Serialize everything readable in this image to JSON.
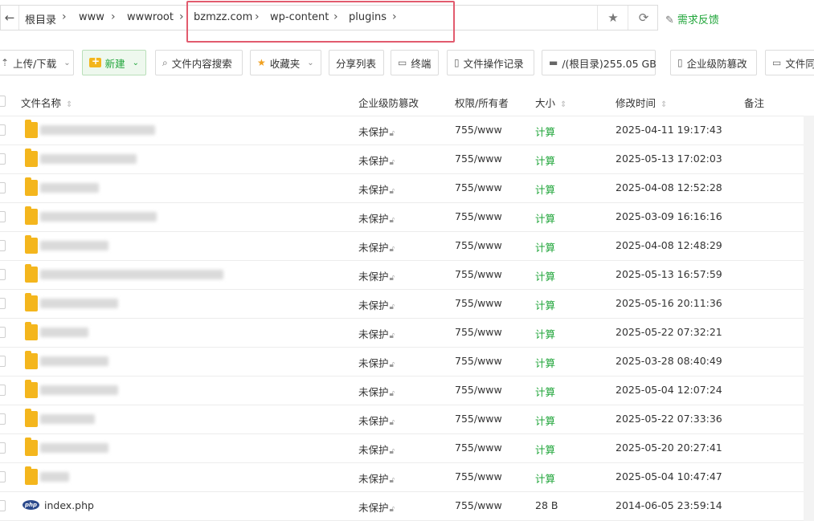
{
  "breadcrumb": {
    "back_icon": "arrow-left-icon",
    "items": [
      "根目录",
      "www",
      "wwwroot",
      "bzmzz.com",
      "wp-content",
      "plugins"
    ],
    "separator": "›"
  },
  "feedback": {
    "label": "需求反馈",
    "icon": "edit-icon"
  },
  "toolbar": {
    "upload": "上传/下载",
    "new": "新建",
    "content_search": "文件内容搜索",
    "favorites": "收藏夹",
    "share_list": "分享列表",
    "terminal": "终端",
    "op_log": "文件操作记录",
    "disk": "/(根目录)255.05 GB",
    "tamper": "企业级防篡改",
    "more": "文件同"
  },
  "table": {
    "columns": {
      "name": "文件名称",
      "protect": "企业级防篡改",
      "perm": "权限/所有者",
      "size": "大小",
      "mtime": "修改时间",
      "note": "备注"
    },
    "rows": [
      {
        "type": "folder",
        "protect": "未保护",
        "perm": "755/www",
        "size": "计算",
        "mtime": "2025-04-11 19:17:43"
      },
      {
        "type": "folder",
        "protect": "未保护",
        "perm": "755/www",
        "size": "计算",
        "mtime": "2025-05-13 17:02:03"
      },
      {
        "type": "folder",
        "protect": "未保护",
        "perm": "755/www",
        "size": "计算",
        "mtime": "2025-04-08 12:52:28"
      },
      {
        "type": "folder",
        "protect": "未保护",
        "perm": "755/www",
        "size": "计算",
        "mtime": "2025-03-09 16:16:16"
      },
      {
        "type": "folder",
        "protect": "未保护",
        "perm": "755/www",
        "size": "计算",
        "mtime": "2025-04-08 12:48:29"
      },
      {
        "type": "folder",
        "protect": "未保护",
        "perm": "755/www",
        "size": "计算",
        "mtime": "2025-05-13 16:57:59"
      },
      {
        "type": "folder",
        "protect": "未保护",
        "perm": "755/www",
        "size": "计算",
        "mtime": "2025-05-16 20:11:36"
      },
      {
        "type": "folder",
        "protect": "未保护",
        "perm": "755/www",
        "size": "计算",
        "mtime": "2025-05-22 07:32:21"
      },
      {
        "type": "folder",
        "protect": "未保护",
        "perm": "755/www",
        "size": "计算",
        "mtime": "2025-03-28 08:40:49"
      },
      {
        "type": "folder",
        "protect": "未保护",
        "perm": "755/www",
        "size": "计算",
        "mtime": "2025-05-04 12:07:24"
      },
      {
        "type": "folder",
        "protect": "未保护",
        "perm": "755/www",
        "size": "计算",
        "mtime": "2025-05-22 07:33:36"
      },
      {
        "type": "folder",
        "protect": "未保护",
        "perm": "755/www",
        "size": "计算",
        "mtime": "2025-05-20 20:27:41"
      },
      {
        "type": "folder",
        "protect": "未保护",
        "perm": "755/www",
        "size": "计算",
        "mtime": "2025-05-04 10:47:47"
      },
      {
        "type": "file",
        "name": "index.php",
        "protect": "未保护",
        "perm": "755/www",
        "size": "28 B",
        "mtime": "2014-06-05 23:59:14"
      }
    ]
  },
  "colors": {
    "accent": "#20a53a",
    "highlight": "#e25b6e",
    "folder": "#f4b61d"
  }
}
